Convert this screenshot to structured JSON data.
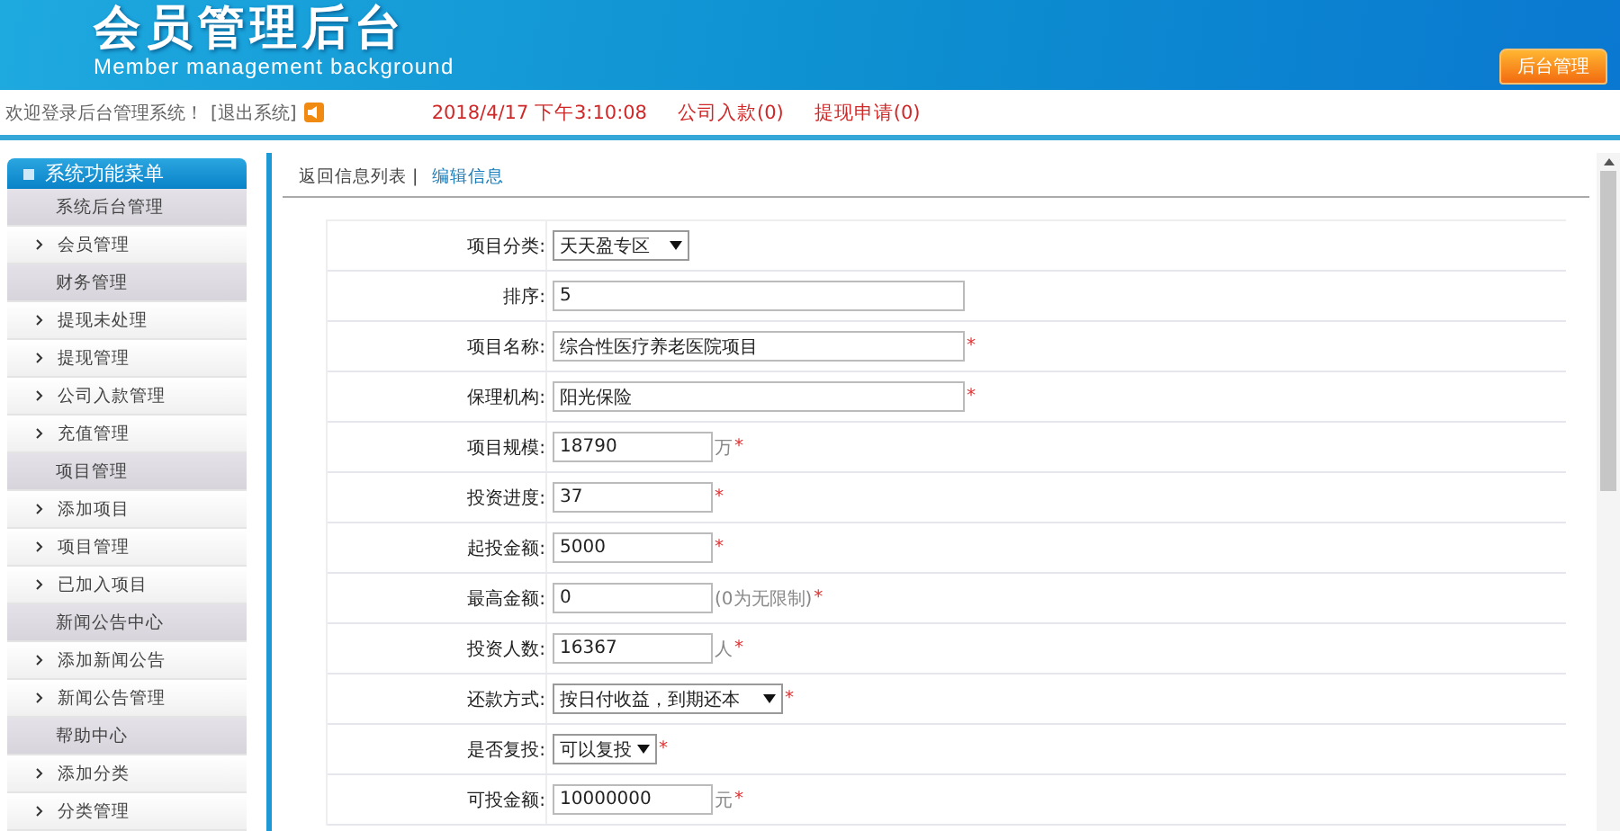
{
  "header": {
    "title": "会员管理后台",
    "subtitle": "Member management background",
    "button": "后台管理"
  },
  "info_bar": {
    "welcome": "欢迎登录后台管理系统！",
    "logout": "[退出系统]",
    "datetime": "2018/4/17 下午3:10:08",
    "links": [
      "公司入款(0)",
      "提现申请(0)"
    ]
  },
  "sidebar": {
    "title": "系统功能菜单",
    "items": [
      {
        "kind": "group",
        "label": "系统后台管理"
      },
      {
        "kind": "item",
        "label": "会员管理"
      },
      {
        "kind": "group",
        "label": "财务管理"
      },
      {
        "kind": "item",
        "label": "提现未处理"
      },
      {
        "kind": "item",
        "label": "提现管理"
      },
      {
        "kind": "item",
        "label": "公司入款管理"
      },
      {
        "kind": "item",
        "label": "充值管理"
      },
      {
        "kind": "group",
        "label": "项目管理"
      },
      {
        "kind": "item",
        "label": "添加项目"
      },
      {
        "kind": "item",
        "label": "项目管理"
      },
      {
        "kind": "item",
        "label": "已加入项目"
      },
      {
        "kind": "group",
        "label": "新闻公告中心"
      },
      {
        "kind": "item",
        "label": "添加新闻公告"
      },
      {
        "kind": "item",
        "label": "新闻公告管理"
      },
      {
        "kind": "group",
        "label": "帮助中心"
      },
      {
        "kind": "item",
        "label": "添加分类"
      },
      {
        "kind": "item",
        "label": "分类管理"
      }
    ]
  },
  "breadcrumb": {
    "back": "返回信息列表 |",
    "current": "编辑信息"
  },
  "form": [
    {
      "label": "项目分类:",
      "kind": "select",
      "value": "天天盈专区"
    },
    {
      "label": "排序:",
      "kind": "wide_input",
      "value": "5"
    },
    {
      "label": "项目名称:",
      "kind": "wide_input",
      "value": "综合性医疗养老医院项目",
      "required_mark": "*"
    },
    {
      "label": "保理机构:",
      "kind": "wide_input",
      "value": "阳光保险",
      "required_mark": "*"
    },
    {
      "label": "项目规模:",
      "kind": "short_input",
      "value": "18790",
      "suffix": "万",
      "required_mark": "*"
    },
    {
      "label": "投资进度:",
      "kind": "short_input",
      "value": "37",
      "required_mark": "*"
    },
    {
      "label": "起投金额:",
      "kind": "short_input",
      "value": "5000",
      "required_mark": "*"
    },
    {
      "label": "最高金额:",
      "kind": "short_input",
      "value": "0",
      "suffix": "(0为无限制)",
      "required_mark": "*"
    },
    {
      "label": "投资人数:",
      "kind": "short_input",
      "value": "16367",
      "suffix": "人",
      "required_mark": "*"
    },
    {
      "label": "还款方式:",
      "kind": "select",
      "value": "按日付收益，到期还本",
      "required_mark": "*"
    },
    {
      "label": "是否复投:",
      "kind": "select",
      "value": "可以复投",
      "required_mark": "*"
    },
    {
      "label": "可投金额:",
      "kind": "short_input",
      "value": "10000000",
      "suffix": "元",
      "required_mark": "*"
    }
  ]
}
